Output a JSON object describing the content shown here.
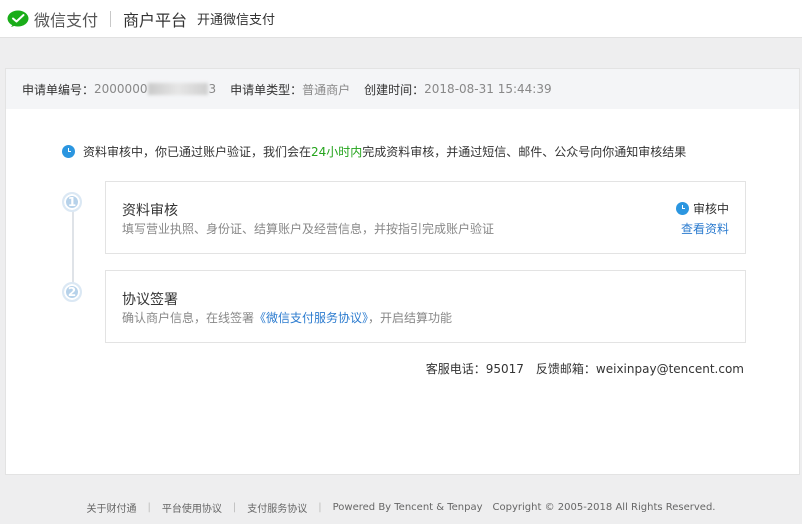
{
  "header": {
    "brand": "微信支付",
    "platform": "商户平台",
    "subtitle": "开通微信支付"
  },
  "info_bar": {
    "order_no_label": "申请单编号：",
    "order_no_value": "2000000",
    "order_no_suffix": "3",
    "type_label": "申请单类型：",
    "type_value": "普通商户",
    "created_label": "创建时间：",
    "created_value": "2018-08-31 15:44:39"
  },
  "notice": {
    "prefix": "资料审核中，你已通过账户验证，我们会在",
    "highlight": "24小时内",
    "suffix": "完成资料审核，并通过短信、邮件、公众号向你通知审核结果"
  },
  "steps": [
    {
      "number": "1",
      "title": "资料审核",
      "desc": "填写营业执照、身份证、结算账户及经营信息，并按指引完成账户验证",
      "status": "审核中",
      "action": "查看资料"
    },
    {
      "number": "2",
      "title": "协议签署",
      "desc_prefix": "确认商户信息，在线签署",
      "desc_link": "《微信支付服务协议》",
      "desc_suffix": "，开启结算功能"
    }
  ],
  "contact": {
    "phone_label": "客服电话：",
    "phone_value": "95017",
    "email_label": "反馈邮箱：",
    "email_value": "weixinpay@tencent.com"
  },
  "footer": {
    "links": [
      "关于财付通",
      "平台使用协议",
      "支付服务协议"
    ],
    "powered": "Powered By Tencent & Tenpay",
    "copyright": "Copyright © 2005-2018 All Rights Reserved."
  },
  "colors": {
    "brand_green": "#1aad19",
    "accent_blue": "#2b96e0",
    "link_blue": "#2b7bcf",
    "highlight_green": "#24a41c"
  }
}
